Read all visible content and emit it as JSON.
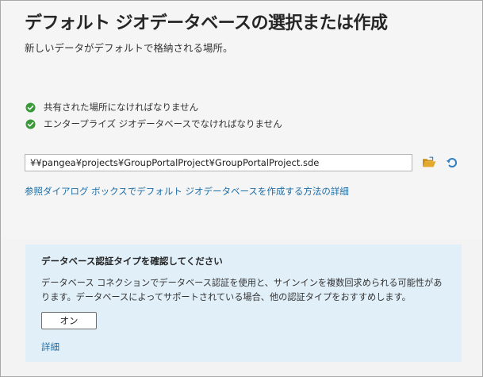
{
  "header": {
    "title": "デフォルト ジオデータベースの選択または作成",
    "subtitle": "新しいデータがデフォルトで格納される場所。"
  },
  "requirements": [
    {
      "text": "共有された場所になければなりません",
      "icon": "check-circle-icon",
      "status": "ok"
    },
    {
      "text": "エンタープライズ ジオデータベースでなければなりません",
      "icon": "check-circle-icon",
      "status": "ok"
    }
  ],
  "path_field": {
    "value": "¥¥pangea¥projects¥GroupPortalProject¥GroupPortalProject.sde"
  },
  "toolbar": {
    "browse_icon": "open-folder-icon",
    "reset_icon": "refresh-icon"
  },
  "help_link": "参照ダイアログ ボックスでデフォルト ジオデータベースを作成する方法の詳細",
  "notice": {
    "title": "データベース認証タイプを確認してください",
    "body": "データベース コネクションでデータベース認証を使用と、サインインを複数回求められる可能性があります。データベースによってサポートされている場合、他の認証タイプをおすすめします。",
    "button_label": "オン",
    "details_link": "詳細"
  },
  "colors": {
    "check_green": "#3a9a3a",
    "link_blue": "#1d6ea6",
    "folder_yellow": "#e3a92b",
    "refresh_blue": "#2f7fc1",
    "notice_background": "#e1eff9"
  }
}
